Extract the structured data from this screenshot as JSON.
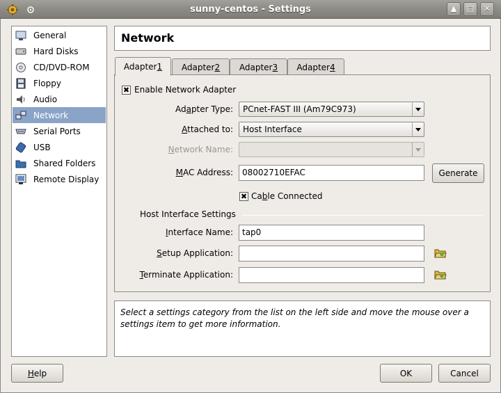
{
  "window": {
    "title": "sunny-centos - Settings",
    "controls": [
      "up-arrow-icon",
      "restore-icon",
      "close-icon"
    ]
  },
  "sidebar": {
    "items": [
      {
        "label": "General",
        "icon": "general-icon",
        "selected": false
      },
      {
        "label": "Hard Disks",
        "icon": "hard-disk-icon",
        "selected": false
      },
      {
        "label": "CD/DVD-ROM",
        "icon": "cd-icon",
        "selected": false
      },
      {
        "label": "Floppy",
        "icon": "floppy-icon",
        "selected": false
      },
      {
        "label": "Audio",
        "icon": "audio-icon",
        "selected": false
      },
      {
        "label": "Network",
        "icon": "network-icon",
        "selected": true
      },
      {
        "label": "Serial Ports",
        "icon": "serial-port-icon",
        "selected": false
      },
      {
        "label": "USB",
        "icon": "usb-icon",
        "selected": false
      },
      {
        "label": "Shared Folders",
        "icon": "shared-folder-icon",
        "selected": false
      },
      {
        "label": "Remote Display",
        "icon": "remote-display-icon",
        "selected": false
      }
    ]
  },
  "header": {
    "title": "Network"
  },
  "tabs": [
    {
      "prefix": "Adapter ",
      "mnemonic": "1",
      "active": true
    },
    {
      "prefix": "Adapter ",
      "mnemonic": "2",
      "active": false
    },
    {
      "prefix": "Adapter ",
      "mnemonic": "3",
      "active": false
    },
    {
      "prefix": "Adapter ",
      "mnemonic": "4",
      "active": false
    }
  ],
  "adapter": {
    "enable_label": "Enable Network Adapter",
    "enable_checked": true,
    "adapter_type": {
      "label_pre": "Ad",
      "label_u": "a",
      "label_post": "pter Type:",
      "value": "PCnet-FAST III (Am79C973)"
    },
    "attached_to": {
      "label_pre": "",
      "label_u": "A",
      "label_post": "ttached to:",
      "value": "Host Interface"
    },
    "network_name": {
      "label_pre": "",
      "label_u": "N",
      "label_post": "etwork Name:",
      "value": ""
    },
    "mac_address": {
      "label_pre": "",
      "label_u": "M",
      "label_post": "AC Address:",
      "value": "08002710EFAC"
    },
    "generate_label": "Generate",
    "cable_connected": {
      "label_pre": "Ca",
      "label_u": "b",
      "label_post": "le Connected",
      "checked": true
    }
  },
  "host_interface": {
    "section_title": "Host Interface Settings",
    "interface_name": {
      "label_pre": "",
      "label_u": "I",
      "label_post": "nterface Name:",
      "value": "tap0"
    },
    "setup_application": {
      "label_pre": "",
      "label_u": "S",
      "label_post": "etup Application:",
      "value": ""
    },
    "terminate_application": {
      "label_pre": "",
      "label_u": "T",
      "label_post": "erminate Application:",
      "value": ""
    }
  },
  "info": {
    "text": "Select a settings category from the list on the left side and move the mouse over a settings item to get more information."
  },
  "footer": {
    "help_pre": "",
    "help_u": "H",
    "help_post": "elp",
    "ok_label": "OK",
    "cancel_label": "Cancel"
  }
}
